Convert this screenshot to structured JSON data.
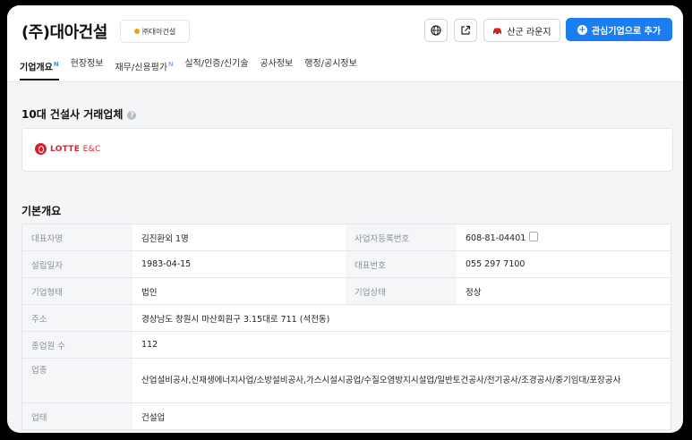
{
  "header": {
    "company_name": "(주)대아건설",
    "logo_text": "㈜대아건설",
    "lounge_label": "산군 라운지",
    "add_button_label": "관심기업으로 추가"
  },
  "tabs": [
    {
      "label": "기업개요",
      "badge": "N"
    },
    {
      "label": "현장정보",
      "badge": ""
    },
    {
      "label": "재무/신용평가",
      "badge": "N"
    },
    {
      "label": "실적/인증/신기술",
      "badge": ""
    },
    {
      "label": "공사정보",
      "badge": ""
    },
    {
      "label": "행정/공시정보",
      "badge": ""
    }
  ],
  "partners": {
    "title": "10대 건설사 거래업체",
    "items": [
      {
        "name": "LOTTE",
        "suffix": "E&C"
      }
    ]
  },
  "overview": {
    "title": "기본개요",
    "rows": {
      "ceo": {
        "label": "대표자명",
        "value": "김진환외 1명"
      },
      "bizno": {
        "label": "사업자등록번호",
        "value": "608-81-04401"
      },
      "founded": {
        "label": "설립일자",
        "value": "1983-04-15"
      },
      "phone": {
        "label": "대표번호",
        "value": "055 297 7100"
      },
      "type": {
        "label": "기업형태",
        "value": "법인"
      },
      "status": {
        "label": "기업상태",
        "value": "정상"
      },
      "address": {
        "label": "주소",
        "value": "경상남도 창원시 마산회원구 3.15대로 711 (석전동)"
      },
      "employees": {
        "label": "종업원 수",
        "value": "112"
      },
      "industry": {
        "label": "업종",
        "value": "산업설비공사,신재생에너지사업/소방설비공사,가스시설시공업/수질오염방지시설업/일반토건공사/전기공사/조경공사/중기임대/포장공사"
      },
      "business": {
        "label": "업태",
        "value": "건설업"
      }
    }
  }
}
